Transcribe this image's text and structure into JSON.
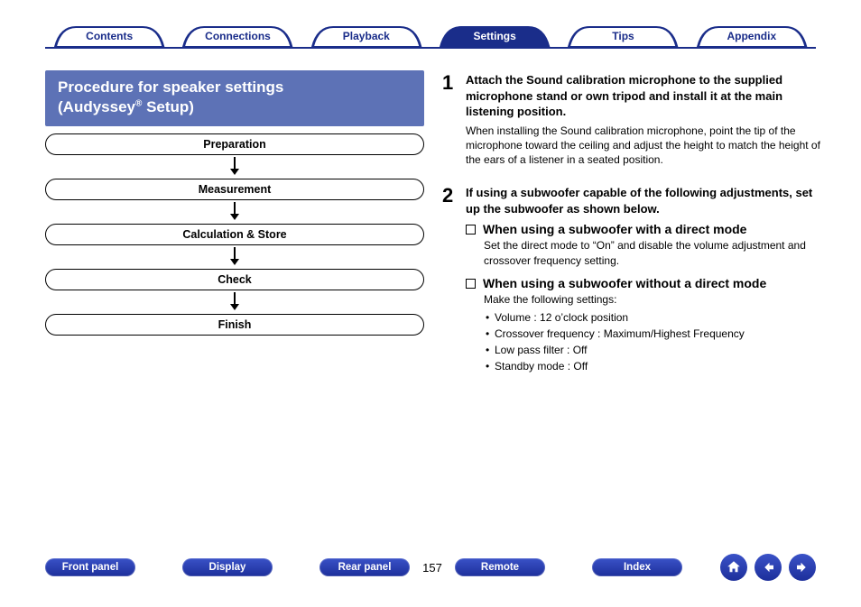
{
  "tabs": {
    "items": [
      {
        "label": "Contents",
        "active": false
      },
      {
        "label": "Connections",
        "active": false
      },
      {
        "label": "Playback",
        "active": false
      },
      {
        "label": "Settings",
        "active": true
      },
      {
        "label": "Tips",
        "active": false
      },
      {
        "label": "Appendix",
        "active": false
      }
    ]
  },
  "section_title": {
    "line1": "Procedure for speaker settings",
    "line2_pre": "(Audyssey",
    "line2_sup": "®",
    "line2_post": " Setup)"
  },
  "flow": [
    "Preparation",
    "Measurement",
    "Calculation & Store",
    "Check",
    "Finish"
  ],
  "steps": {
    "s1": {
      "num": "1",
      "head": "Attach the Sound calibration microphone to the supplied microphone stand or own tripod and install it at the main listening position.",
      "sub": "When installing the Sound calibration microphone, point the tip of the microphone toward the ceiling and adjust the height to match the height of the ears of a listener in a seated position."
    },
    "s2": {
      "num": "2",
      "head": "If using a subwoofer capable of the following adjustments, set up the subwoofer as shown below.",
      "a_title": "When using a subwoofer with a direct mode",
      "a_body": "Set the direct mode to “On” and disable the volume adjustment and crossover frequency setting.",
      "b_title": "When using a subwoofer without a direct mode",
      "b_lead": "Make the following settings:",
      "b_items": [
        "Volume : 12 o’clock position",
        "Crossover frequency : Maximum/Highest Frequency",
        "Low pass filter : Off",
        "Standby mode : Off"
      ]
    }
  },
  "bottom": {
    "front": "Front panel",
    "display": "Display",
    "rear": "Rear panel",
    "page": "157",
    "remote": "Remote",
    "index": "Index"
  },
  "nav_icons": {
    "home": "home-icon",
    "prev": "arrow-left-icon",
    "next": "arrow-right-icon"
  },
  "colors": {
    "brand": "#1a2d8a"
  }
}
